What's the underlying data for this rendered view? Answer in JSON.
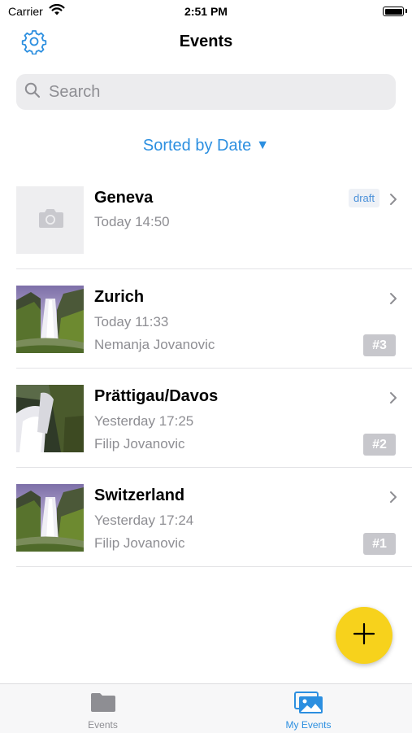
{
  "status_bar": {
    "carrier": "Carrier",
    "time": "2:51 PM"
  },
  "header": {
    "title": "Events",
    "settings_icon": "gear-icon"
  },
  "search": {
    "placeholder": "Search",
    "value": ""
  },
  "sort": {
    "label": "Sorted by Date",
    "arrow": "▼"
  },
  "events": [
    {
      "title": "Geneva",
      "time": "Today 14:50",
      "author": "",
      "badge": "draft",
      "thumbnail": "camera-icon"
    },
    {
      "title": "Zurich",
      "time": "Today 11:33",
      "author": "Nemanja Jovanovic",
      "badge": "#3",
      "thumbnail": "waterfall-photo"
    },
    {
      "title": "Prättigau/Davos",
      "time": "Yesterday 17:25",
      "author": "Filip Jovanovic",
      "badge": "#2",
      "thumbnail": "waterfall-photo"
    },
    {
      "title": "Switzerland",
      "time": "Yesterday 17:24",
      "author": "Filip Jovanovic",
      "badge": "#1",
      "thumbnail": "waterfall-photo"
    }
  ],
  "fab": {
    "icon": "plus-icon"
  },
  "tabs": [
    {
      "label": "Events",
      "icon": "folder-icon",
      "active": false
    },
    {
      "label": "My Events",
      "icon": "photos-icon",
      "active": true
    }
  ],
  "colors": {
    "accent": "#2c8fe0",
    "fab": "#f7d21c",
    "badge_gray": "#c7c7cc",
    "secondary_text": "#8e8e93"
  }
}
